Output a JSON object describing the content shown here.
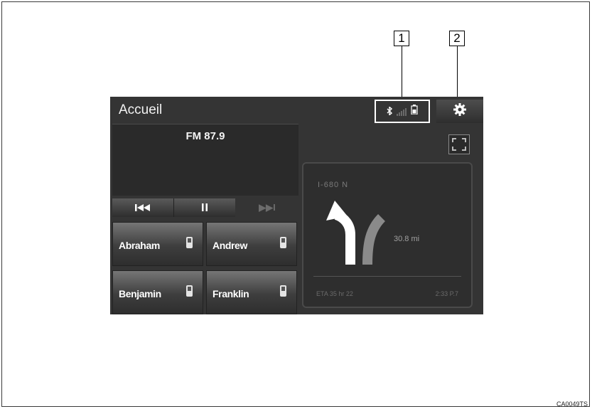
{
  "callouts": [
    "1",
    "2"
  ],
  "screen": {
    "title": "Accueil",
    "status_icons": [
      "bluetooth-icon",
      "signal-icon",
      "battery-icon"
    ],
    "settings_icon": "gear-icon",
    "media": {
      "station": "FM 87.9",
      "prev_glyph": "⏮",
      "pause_glyph": "⏸",
      "next_glyph": "▶▶I"
    },
    "favorites": [
      {
        "name": "Abraham"
      },
      {
        "name": "Andrew"
      },
      {
        "name": "Benjamin"
      },
      {
        "name": "Franklin"
      }
    ],
    "expand_icon": "fullscreen-icon",
    "navigation": {
      "road": "I-680 N",
      "distance": "30.8 mi",
      "eta": "ETA 35 hr 22",
      "time": "2:33 P.7"
    }
  },
  "figure_code": "CA0049TS",
  "colors": {
    "screen_bg": "#343434",
    "button_gradient_top": "#767676",
    "arrow_white": "#ffffff"
  }
}
